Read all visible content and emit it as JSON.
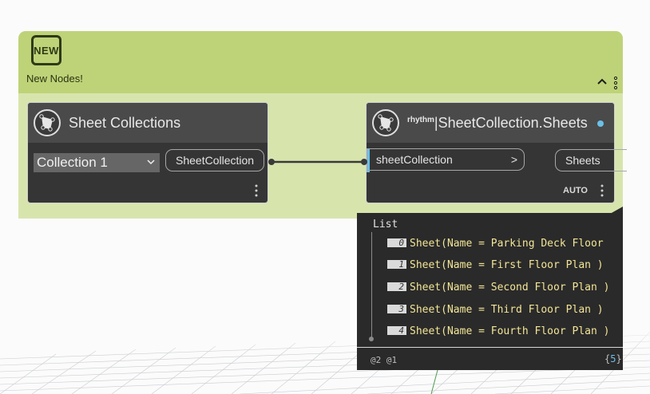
{
  "group": {
    "badge_label": "NEW",
    "title": "New Nodes!",
    "color": "#bed378"
  },
  "node_collections": {
    "title": "Sheet Collections",
    "dropdown_value": "Collection 1",
    "output_port": "SheetCollection",
    "icon": "dynamo-node-icon"
  },
  "node_sheets": {
    "title_prefix": "rhythm",
    "title": "|SheetCollection.Sheets",
    "input_port": "sheetCollection",
    "input_chevron": ">",
    "output_port": "Sheets",
    "lacing": "AUTO",
    "icon": "dynamo-node-icon",
    "accent_color": "#6ac0e7"
  },
  "preview": {
    "root_label": "List",
    "items": [
      {
        "index": "0",
        "value": "Sheet(Name = Parking Deck Floor"
      },
      {
        "index": "1",
        "value": "Sheet(Name = First Floor Plan )"
      },
      {
        "index": "2",
        "value": "Sheet(Name = Second Floor Plan )"
      },
      {
        "index": "3",
        "value": "Sheet(Name = Third Floor Plan )"
      },
      {
        "index": "4",
        "value": "Sheet(Name = Fourth Floor Plan )"
      }
    ],
    "levels": "@2 @1",
    "count": "5",
    "count_open": "{",
    "count_close": "}"
  }
}
